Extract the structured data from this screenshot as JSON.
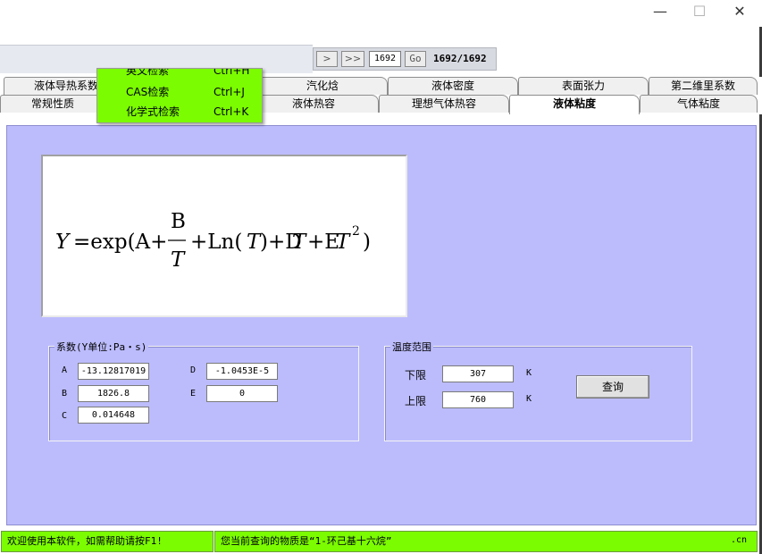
{
  "window": {
    "minimize": "—",
    "maximize": "☐",
    "close": "✕"
  },
  "toolbar": {
    "next": ">",
    "last": ">>",
    "record_input": "1692",
    "go": "Go",
    "count": "1692/1692"
  },
  "tabs_row1": [
    "液体导热系数",
    "汽化焓",
    "液体密度",
    "表面张力",
    "第二维里系数"
  ],
  "tabs_row2": [
    "常规性质",
    "液体热容",
    "理想气体热容",
    "液体粘度",
    "气体粘度"
  ],
  "menu": [
    {
      "label": "英文检索",
      "shortcut": "Ctrl+H"
    },
    {
      "label": "CAS检索",
      "shortcut": "Ctrl+J"
    },
    {
      "label": "化学式检索",
      "shortcut": "Ctrl+K"
    }
  ],
  "coefficients": {
    "title": "系数(Y单位:Pa・s)",
    "A": {
      "label": "A",
      "value": "-13.12817019"
    },
    "B": {
      "label": "B",
      "value": "1826.8"
    },
    "C": {
      "label": "C",
      "value": "0.014648"
    },
    "D": {
      "label": "D",
      "value": "-1.0453E-5"
    },
    "E": {
      "label": "E",
      "value": "0"
    }
  },
  "temperature": {
    "title": "温度范围",
    "lower_label": "下限",
    "lower_value": "307",
    "lower_unit": "K",
    "upper_label": "上限",
    "upper_value": "760",
    "upper_unit": "K",
    "query": "查询"
  },
  "status": {
    "left": "欢迎使用本软件，如需帮助请按F1!",
    "middle": "您当前查询的物质是“1-环己基十六烷”",
    "right": ".cn"
  },
  "colors": {
    "panel": "#bcbcfd",
    "status_green": "#7cfc00",
    "menu_green": "#7cfc00"
  }
}
